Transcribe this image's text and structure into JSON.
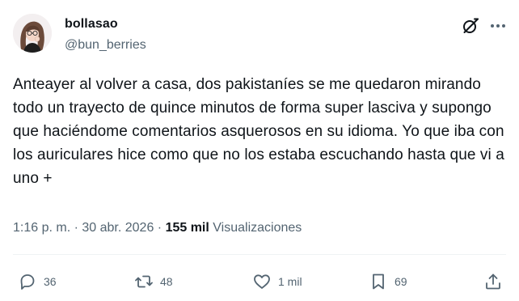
{
  "author": {
    "display_name": "bollasao",
    "handle": "@bun_berries",
    "avatar_icon": "avatar-illustration-icon"
  },
  "header_icons": {
    "grok": "grok-icon",
    "more": "more-options-icon"
  },
  "tweet": {
    "text": "Anteayer al volver a casa, dos pakistaníes se me quedaron mirando todo un trayecto de quince minutos de forma super lasciva y supongo que haciéndome comentarios asquerosos en su idioma. Yo que iba con los auriculares hice como que no los estaba escuchando hasta que vi a uno +"
  },
  "meta": {
    "time": "1:16 p. m.",
    "separator": " · ",
    "date": "30 abr. 2026",
    "views_count": "155 mil",
    "views_label": "Visualizaciones"
  },
  "actions": {
    "reply": {
      "icon": "reply-icon",
      "count": "36"
    },
    "retweet": {
      "icon": "retweet-icon",
      "count": "48"
    },
    "like": {
      "icon": "heart-icon",
      "count": "1 mil"
    },
    "bookmark": {
      "icon": "bookmark-icon",
      "count": "69"
    },
    "share": {
      "icon": "share-icon"
    }
  },
  "colors": {
    "text_primary": "#0f1419",
    "text_secondary": "#536471",
    "divider": "#eff3f4",
    "background": "#ffffff"
  }
}
